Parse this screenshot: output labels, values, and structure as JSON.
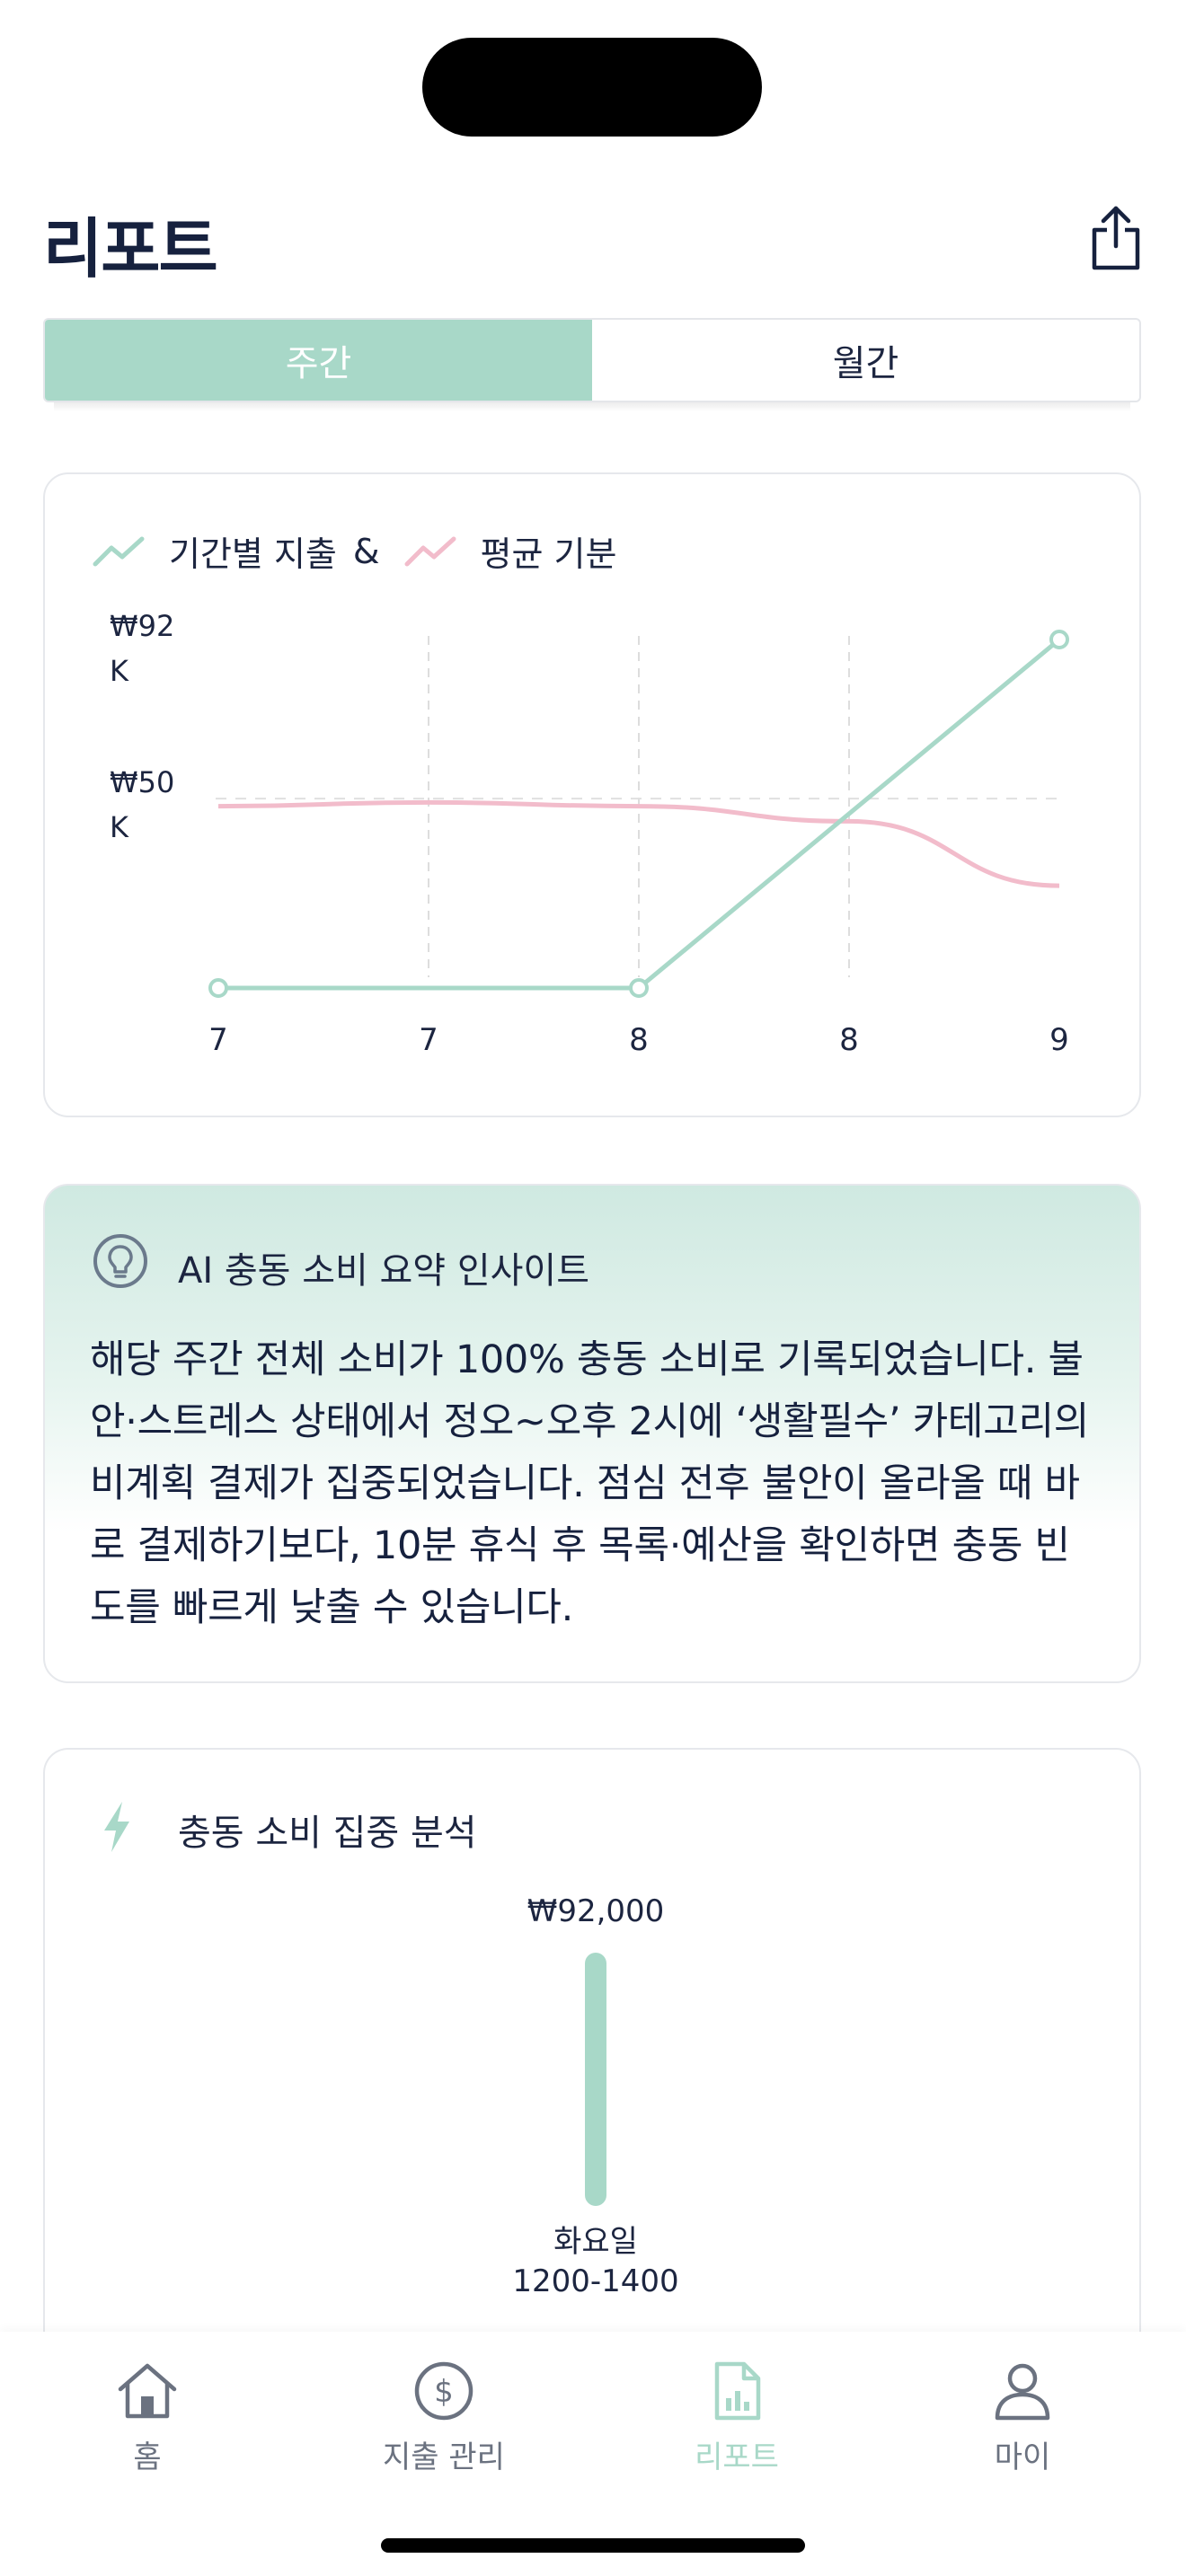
{
  "header": {
    "title": "리포트"
  },
  "segment": {
    "weekly": "주간",
    "monthly": "월간",
    "selected": "weekly"
  },
  "chart_card": {
    "legend": {
      "series1": "기간별 지출",
      "amp": "&",
      "series2": "평균 기분"
    }
  },
  "chart_data": {
    "type": "line",
    "categories": [
      "7",
      "7",
      "8",
      "8",
      "9"
    ],
    "y_tick_labels": [
      "₩92\nK",
      "₩50\nK"
    ],
    "series": [
      {
        "name": "기간별 지출",
        "color": "#a8d8c8",
        "values": [
          0,
          null,
          0,
          null,
          92
        ]
      },
      {
        "name": "평균 기분",
        "color": "#f2bccb",
        "values": [
          48,
          49,
          48,
          44,
          27
        ]
      }
    ],
    "ylim": [
      0,
      92
    ],
    "reference_line": 50,
    "grid": "vertical dashed"
  },
  "insight": {
    "title": "AI 충동 소비 요약 인사이트",
    "body": "해당 주간 전체 소비가 100% 충동 소비로 기록되었습니다. 불안·스트레스 상태에서 정오~오후 2시에 ‘생활필수’ 카테고리의 비계획 결제가 집중되었습니다. 점심 전후 불안이 올라올 때 바로 결제하기보다, 10분 휴식 후 목록·예산을 확인하면 충동 빈도를 빠르게 낮출 수 있습니다."
  },
  "impulse": {
    "title": "충동 소비 집중 분석",
    "bars": [
      {
        "value_label": "₩92,000",
        "value": 92000,
        "day": "화요일",
        "time": "1200-1400"
      }
    ]
  },
  "tabbar": {
    "items": [
      {
        "label": "홈",
        "icon": "home-icon"
      },
      {
        "label": "지출 관리",
        "icon": "dollar-icon"
      },
      {
        "label": "리포트",
        "icon": "report-icon",
        "active": true
      },
      {
        "label": "마이",
        "icon": "user-icon"
      }
    ]
  },
  "colors": {
    "accent": "#a8d8c8",
    "mood": "#f2bccb",
    "text": "#1c2540"
  }
}
